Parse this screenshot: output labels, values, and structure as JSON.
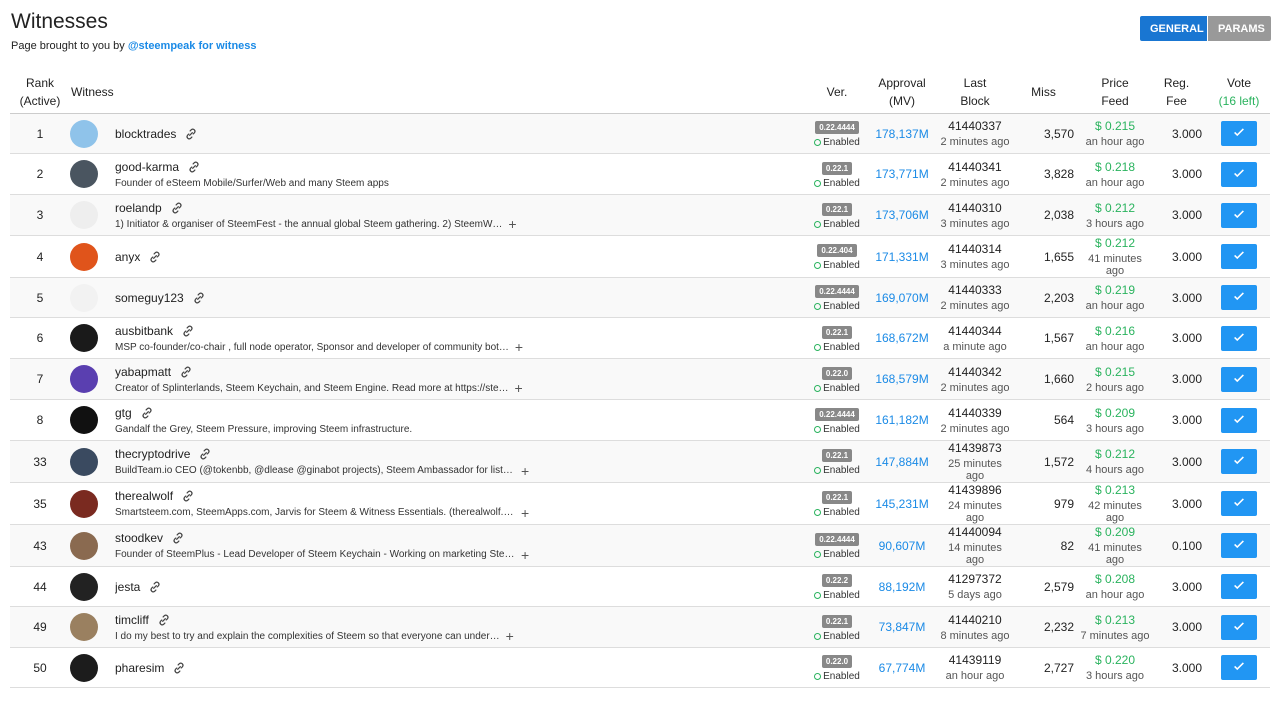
{
  "page": {
    "title": "Witnesses",
    "subtitle_prefix": "Page brought to you by",
    "subtitle_link": "@steempeak for witness"
  },
  "tabs": [
    {
      "label": "GENERAL",
      "active": true
    },
    {
      "label": "PARAMS",
      "active": false
    }
  ],
  "columns": {
    "rank": "Rank",
    "rank_sub": "(Active)",
    "witness": "Witness",
    "ver": "Ver.",
    "approval": "Approval",
    "approval_sub": "(MV)",
    "last": "Last",
    "last_sub": "Block",
    "miss": "Miss",
    "price": "Price",
    "price_sub": "Feed",
    "fee": "Reg.",
    "fee_sub": "Fee",
    "vote": "Vote",
    "vote_sub": "(16 left)"
  },
  "rows": [
    {
      "rank": "1",
      "name": "blocktrades",
      "desc": "",
      "version": "0.22.4444",
      "status": "Enabled",
      "approval": "178,137M",
      "block": "41440337",
      "block_time": "2 minutes ago",
      "miss": "3,570",
      "price": "$ 0.215",
      "price_time": "an hour ago",
      "fee": "3.000",
      "avatar_color": "#8fc3ea"
    },
    {
      "rank": "2",
      "name": "good-karma",
      "desc": "Founder of eSteem Mobile/Surfer/Web and many Steem apps",
      "version": "0.22.1",
      "status": "Enabled",
      "approval": "173,771M",
      "block": "41440341",
      "block_time": "2 minutes ago",
      "miss": "3,828",
      "price": "$ 0.218",
      "price_time": "an hour ago",
      "fee": "3.000",
      "avatar_color": "#4a5560"
    },
    {
      "rank": "3",
      "name": "roelandp",
      "desc": "1) Initiator & organiser of SteemFest - the annual global Steem gathering. 2) SteemW…",
      "version": "0.22.1",
      "status": "Enabled",
      "approval": "173,706M",
      "block": "41440310",
      "block_time": "3 minutes ago",
      "miss": "2,038",
      "price": "$ 0.212",
      "price_time": "3 hours ago",
      "fee": "3.000",
      "avatar_color": "#eeeeee"
    },
    {
      "rank": "4",
      "name": "anyx",
      "desc": "",
      "version": "0.22.404",
      "status": "Enabled",
      "approval": "171,331M",
      "block": "41440314",
      "block_time": "3 minutes ago",
      "miss": "1,655",
      "price": "$ 0.212",
      "price_time": "41 minutes ago",
      "fee": "3.000",
      "avatar_color": "#e0541b"
    },
    {
      "rank": "5",
      "name": "someguy123",
      "desc": "",
      "version": "0.22.4444",
      "status": "Enabled",
      "approval": "169,070M",
      "block": "41440333",
      "block_time": "2 minutes ago",
      "miss": "2,203",
      "price": "$ 0.219",
      "price_time": "an hour ago",
      "fee": "3.000",
      "avatar_color": "#f2f2f2"
    },
    {
      "rank": "6",
      "name": "ausbitbank",
      "desc": "MSP co-founder/co-chair , full node operator, Sponsor and developer of community bot…",
      "version": "0.22.1",
      "status": "Enabled",
      "approval": "168,672M",
      "block": "41440344",
      "block_time": "a minute ago",
      "miss": "1,567",
      "price": "$ 0.216",
      "price_time": "an hour ago",
      "fee": "3.000",
      "avatar_color": "#1a1a1a"
    },
    {
      "rank": "7",
      "name": "yabapmatt",
      "desc": "Creator of Splinterlands, Steem Keychain, and Steem Engine. Read more at https://ste…",
      "version": "0.22.0",
      "status": "Enabled",
      "approval": "168,579M",
      "block": "41440342",
      "block_time": "2 minutes ago",
      "miss": "1,660",
      "price": "$ 0.215",
      "price_time": "2 hours ago",
      "fee": "3.000",
      "avatar_color": "#5a3fb0"
    },
    {
      "rank": "8",
      "name": "gtg",
      "desc": "Gandalf the Grey, Steem Pressure, improving Steem infrastructure.",
      "version": "0.22.4444",
      "status": "Enabled",
      "approval": "161,182M",
      "block": "41440339",
      "block_time": "2 minutes ago",
      "miss": "564",
      "price": "$ 0.209",
      "price_time": "3 hours ago",
      "fee": "3.000",
      "avatar_color": "#111111"
    },
    {
      "rank": "33",
      "name": "thecryptodrive",
      "desc": "BuildTeam.io CEO (@tokenbb, @dlease @ginabot projects), Steem Ambassador for listing…",
      "version": "0.22.1",
      "status": "Enabled",
      "approval": "147,884M",
      "block": "41439873",
      "block_time": "25 minutes ago",
      "miss": "1,572",
      "price": "$ 0.212",
      "price_time": "4 hours ago",
      "fee": "3.000",
      "avatar_color": "#3a4a60"
    },
    {
      "rank": "35",
      "name": "therealwolf",
      "desc": "Smartsteem.com, SteemApps.com, Jarvis for Steem & Witness Essentials. (therealwolf.m…",
      "version": "0.22.1",
      "status": "Enabled",
      "approval": "145,231M",
      "block": "41439896",
      "block_time": "24 minutes ago",
      "miss": "979",
      "price": "$ 0.213",
      "price_time": "42 minutes ago",
      "fee": "3.000",
      "avatar_color": "#7a2a20"
    },
    {
      "rank": "43",
      "name": "stoodkev",
      "desc": "Founder of SteemPlus - Lead Developer of Steem Keychain - Working on marketing Steem…",
      "version": "0.22.4444",
      "status": "Enabled",
      "approval": "90,607M",
      "block": "41440094",
      "block_time": "14 minutes ago",
      "miss": "82",
      "price": "$ 0.209",
      "price_time": "41 minutes ago",
      "fee": "0.100",
      "avatar_color": "#8a6a50"
    },
    {
      "rank": "44",
      "name": "jesta",
      "desc": "",
      "version": "0.22.2",
      "status": "Enabled",
      "approval": "88,192M",
      "block": "41297372",
      "block_time": "5 days ago",
      "miss": "2,579",
      "price": "$ 0.208",
      "price_time": "an hour ago",
      "fee": "3.000",
      "avatar_color": "#222222"
    },
    {
      "rank": "49",
      "name": "timcliff",
      "desc": "I do my best to try and explain the complexities of Steem so that everyone can under…",
      "version": "0.22.1",
      "status": "Enabled",
      "approval": "73,847M",
      "block": "41440210",
      "block_time": "8 minutes ago",
      "miss": "2,232",
      "price": "$ 0.213",
      "price_time": "7 minutes ago",
      "fee": "3.000",
      "avatar_color": "#9a8060"
    },
    {
      "rank": "50",
      "name": "pharesim",
      "desc": "",
      "version": "0.22.0",
      "status": "Enabled",
      "approval": "67,774M",
      "block": "41439119",
      "block_time": "an hour ago",
      "miss": "2,727",
      "price": "$ 0.220",
      "price_time": "3 hours ago",
      "fee": "3.000",
      "avatar_color": "#1c1c1c"
    }
  ]
}
